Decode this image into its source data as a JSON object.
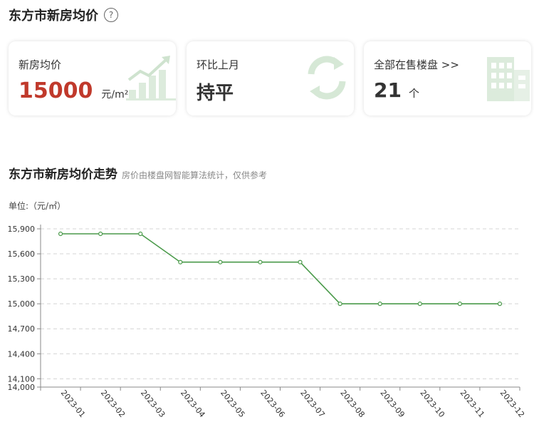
{
  "header": {
    "title": "东方市新房均价",
    "help_icon": "question-circle-icon"
  },
  "cards": {
    "price": {
      "label": "新房均价",
      "value": "15000",
      "unit": "元/m²",
      "icon": "rising-bar-chart-icon"
    },
    "trend": {
      "label": "环比上月",
      "value": "持平",
      "icon": "refresh-cycle-icon"
    },
    "listings": {
      "label": "全部在售楼盘 >>",
      "value": "21",
      "unit": "个",
      "icon": "building-icon"
    }
  },
  "section": {
    "title": "东方市新房均价走势",
    "note": "房价由楼盘网智能算法统计，仅供参考"
  },
  "colors": {
    "price": "#c0392b",
    "line": "#4a9a4a",
    "icon_bg": "#e3efe3"
  },
  "chart_data": {
    "type": "line",
    "unit_label": "单位:（元/㎡）",
    "categories": [
      "2023-01",
      "2023-02",
      "2023-03",
      "2023-04",
      "2023-05",
      "2023-06",
      "2023-07",
      "2023-08",
      "2023-09",
      "2023-10",
      "2023-11",
      "2023-12"
    ],
    "series": [
      {
        "values": [
          15840,
          15840,
          15840,
          15500,
          15500,
          15500,
          15500,
          15000,
          15000,
          15000,
          15000,
          15000
        ]
      }
    ],
    "y_ticks": [
      14000,
      14100,
      14400,
      14700,
      15000,
      15300,
      15600,
      15900
    ],
    "ylim": [
      14000,
      15900
    ],
    "grid": true
  }
}
